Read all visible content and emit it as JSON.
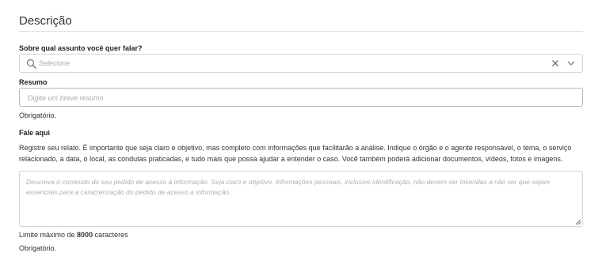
{
  "section": {
    "title": "Descrição"
  },
  "subject": {
    "label": "Sobre qual assunto você quer falar?",
    "placeholder": "Selecione"
  },
  "summary": {
    "label": "Resumo",
    "placeholder": "Digite um breve resumo",
    "required_text": "Obrigatório."
  },
  "report": {
    "label": "Fale aqui",
    "instructions": "Registre seu relato. É importante que seja claro e objetivo, mas completo com informações que facilitarão a análise. Indique o órgão e o agente responsável, o tema, o serviço relacionado, a data, o local, as condutas praticadas, e tudo mais que possa ajudar a entender o caso. Você também poderá adicionar documentos, vídeos, fotos e imagens.",
    "placeholder": "Descreva o conteúdo do seu pedido de acesso à informação. Seja claro e objetivo. Informações pessoais, inclusive identificação, não devem ser inseridas a não ser que sejam essenciais para a caracterização do pedido de acesso à informação.",
    "limit_prefix": "Limite máximo de",
    "limit_value": "8000",
    "limit_suffix": "caracteres",
    "required_text": "Obrigatório."
  }
}
